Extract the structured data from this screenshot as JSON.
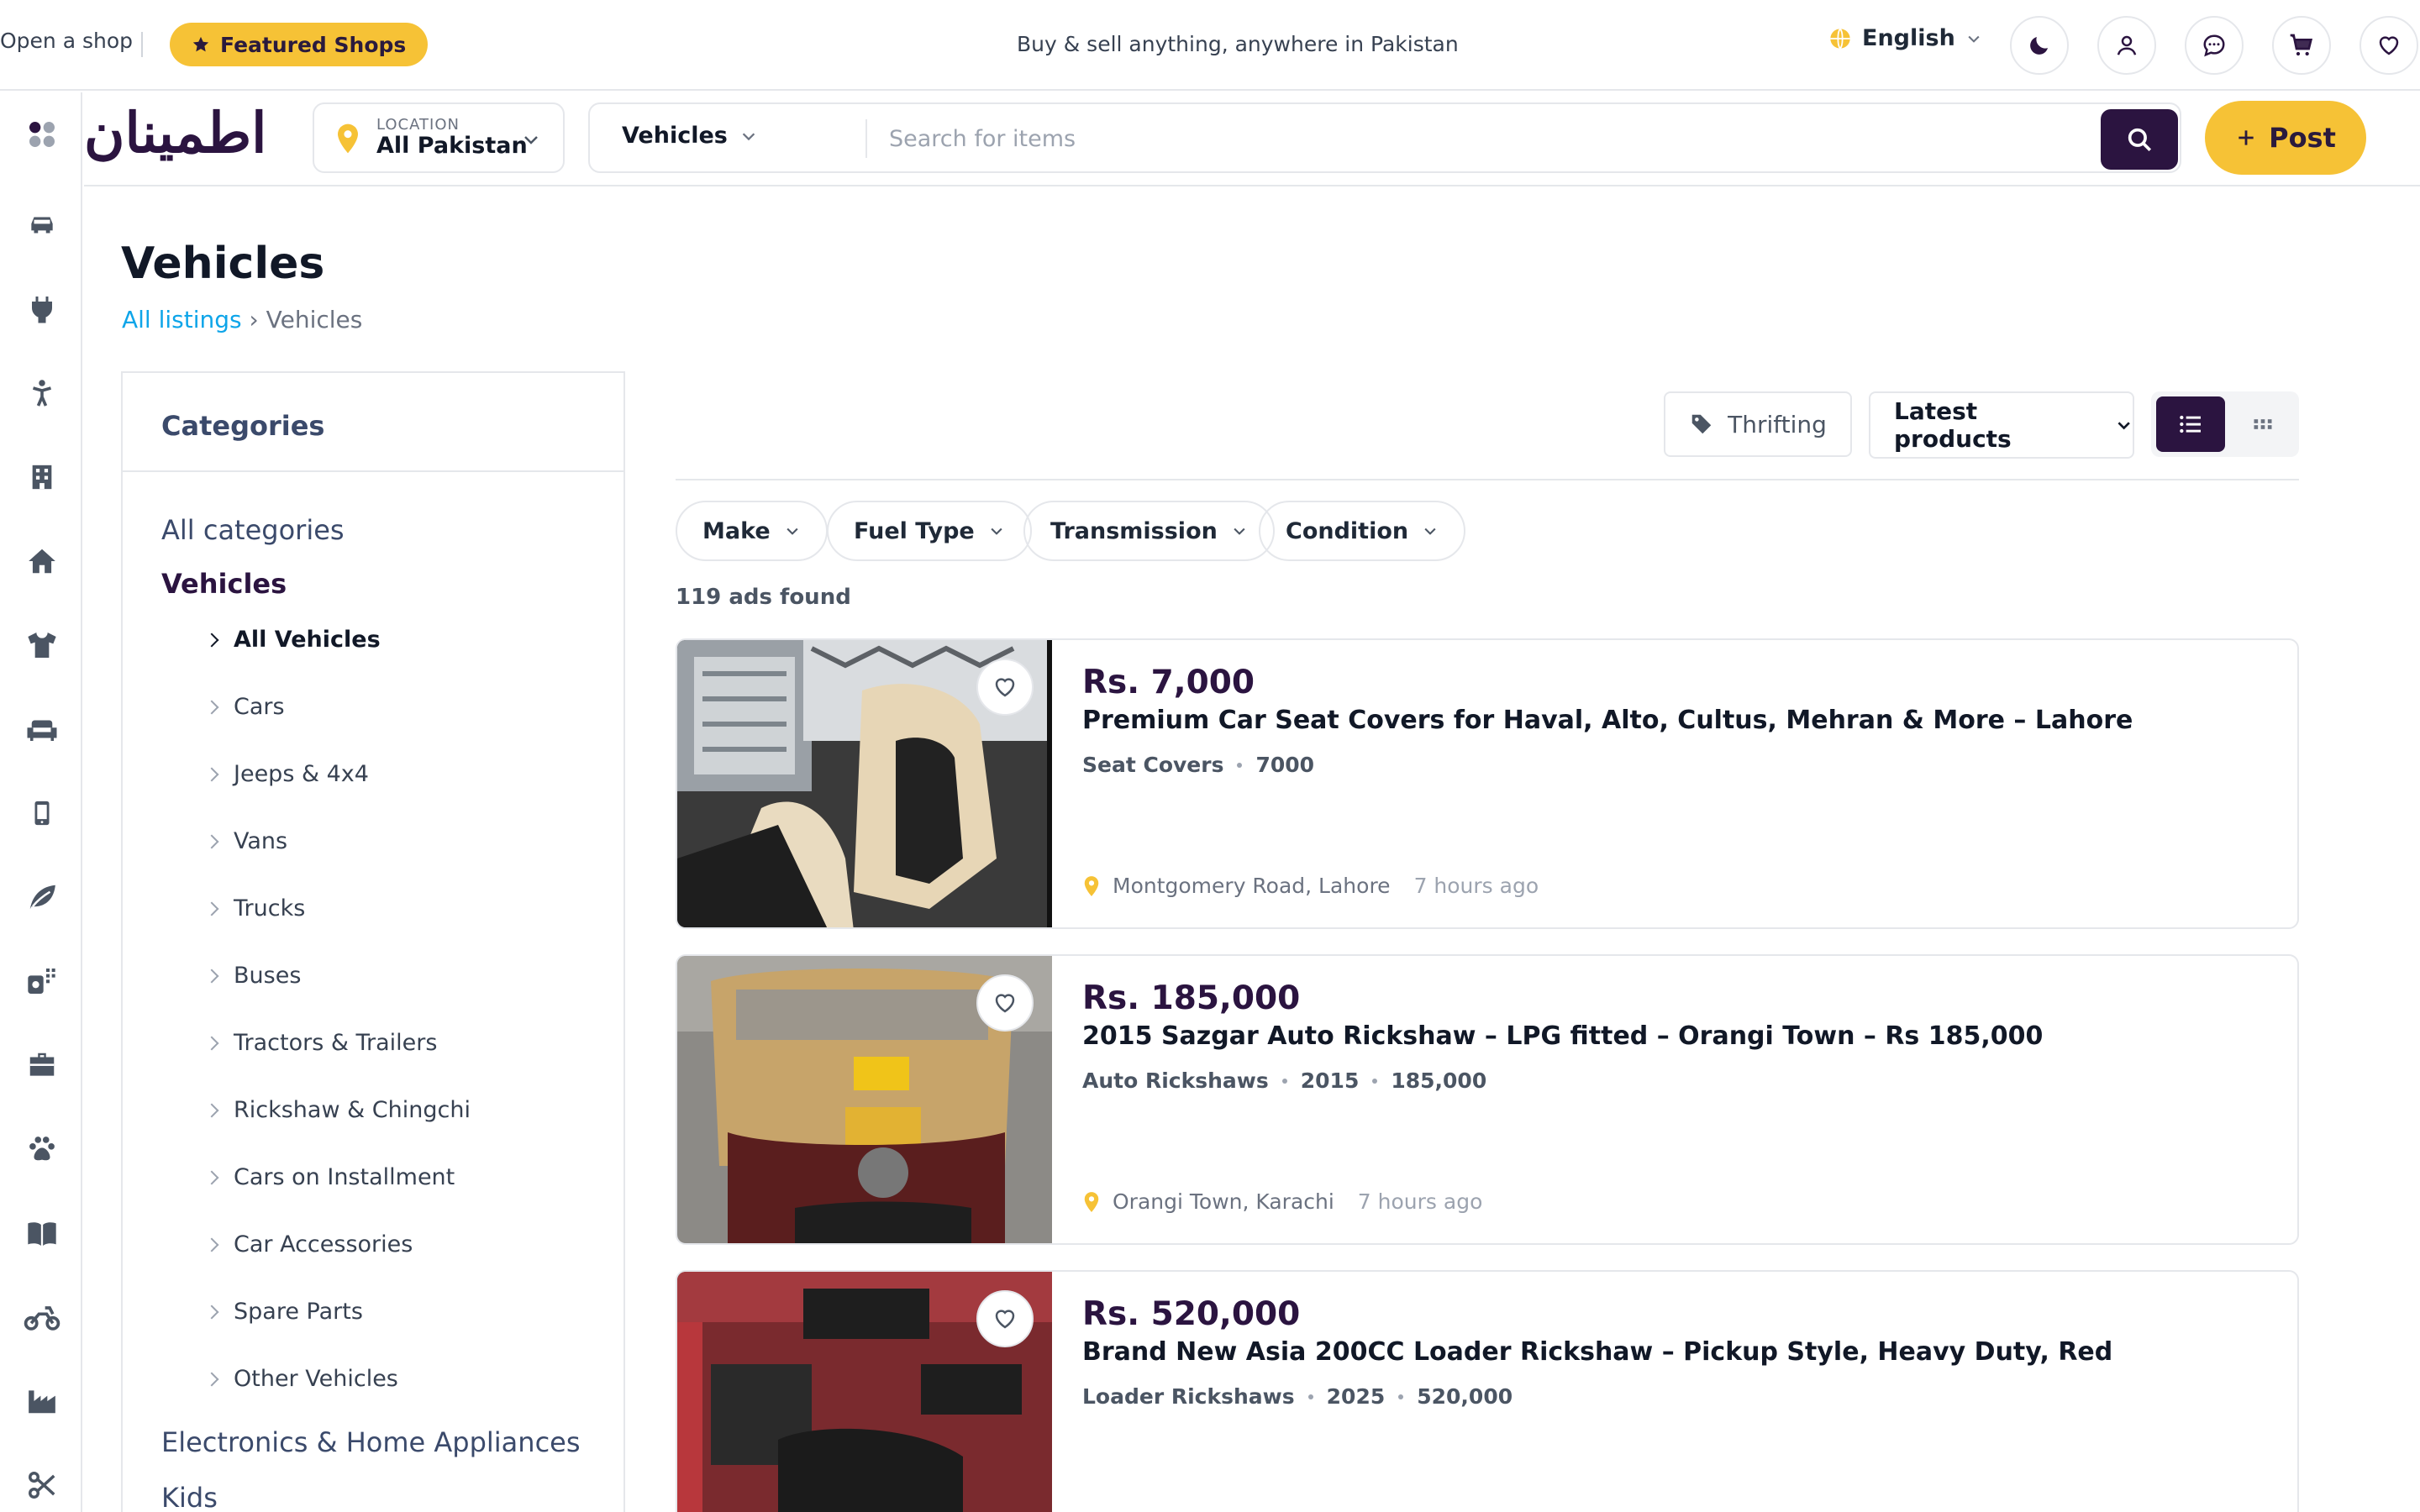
{
  "topbar": {
    "open_shop": "Open a shop",
    "featured_shops": "Featured Shops",
    "tagline": "Buy & sell anything, anywhere in Pakistan",
    "language": "English"
  },
  "header": {
    "logo_text": "اطمینان",
    "location_label": "LOCATION",
    "location_value": "All Pakistan",
    "search_category": "Vehicles",
    "search_placeholder": "Search for items",
    "post_label": "Post"
  },
  "page": {
    "title": "Vehicles",
    "breadcrumb_link": "All listings",
    "breadcrumb_sep": "›",
    "breadcrumb_current": "Vehicles"
  },
  "categories": {
    "heading": "Categories",
    "all": "All categories",
    "active": "Vehicles",
    "sub": [
      "All Vehicles",
      "Cars",
      "Jeeps & 4x4",
      "Vans",
      "Trucks",
      "Buses",
      "Tractors & Trailers",
      "Rickshaw & Chingchi",
      "Cars on Installment",
      "Car Accessories",
      "Spare Parts",
      "Other Vehicles"
    ],
    "others": [
      "Electronics & Home Appliances",
      "Kids"
    ]
  },
  "toolbar": {
    "thrifting": "Thrifting",
    "sort": "Latest products"
  },
  "filters": [
    "Make",
    "Fuel Type",
    "Transmission",
    "Condition"
  ],
  "ads_count": "119 ads found",
  "listings": [
    {
      "price": "Rs. 7,000",
      "title": "Premium Car Seat Covers for Haval, Alto, Cultus, Mehran & More – Lahore",
      "meta": [
        "Seat Covers",
        "7000"
      ],
      "location": "Montgomery Road, Lahore",
      "time": "7 hours ago"
    },
    {
      "price": "Rs. 185,000",
      "title": "2015 Sazgar Auto Rickshaw – LPG fitted – Orangi Town – Rs 185,000",
      "meta": [
        "Auto Rickshaws",
        "2015",
        "185,000"
      ],
      "location": "Orangi Town, Karachi",
      "time": "7 hours ago"
    },
    {
      "price": "Rs. 520,000",
      "title": "Brand New Asia 200CC Loader Rickshaw – Pickup Style, Heavy Duty, Red",
      "meta": [
        "Loader Rickshaws",
        "2025",
        "520,000"
      ],
      "location": "",
      "time": ""
    }
  ],
  "colors": {
    "brand": "#2b1440",
    "accent": "#f6c236",
    "link": "#0ea5e9"
  },
  "icons": {
    "rail": [
      "apps-icon",
      "car-icon",
      "plug-icon",
      "child-icon",
      "building-icon",
      "home-icon",
      "tshirt-icon",
      "sofa-icon",
      "mobile-icon",
      "leaf-icon",
      "services-icon",
      "briefcase-icon",
      "paw-icon",
      "book-icon",
      "motorcycle-icon",
      "factory-icon",
      "scissors-icon"
    ]
  }
}
